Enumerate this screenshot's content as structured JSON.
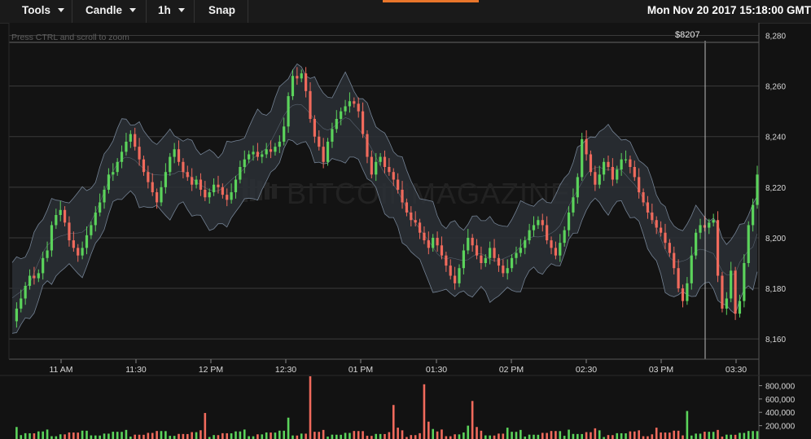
{
  "toolbar": {
    "tools_label": "Tools",
    "candle_label": "Candle",
    "interval_label": "1h",
    "snap_label": "Snap",
    "clock": "Mon Nov 20 2017 15:18:00 GMT"
  },
  "hint": "Press CTRL and scroll to zoom",
  "price_tag": "$8207",
  "watermark": "BITCOINMAGAZINE",
  "colors": {
    "up": "#5bd35b",
    "down": "#f06a5c",
    "band_fill": "#2b3036",
    "band_line": "#8a9bb0",
    "grid": "#3b3b3b"
  },
  "chart_data": {
    "type": "candlestick",
    "title": "",
    "y_ticks": [
      "8,280",
      "8,260",
      "8,240",
      "8,220",
      "8,200",
      "8,180",
      "8,160"
    ],
    "y_tick_values": [
      8280,
      8260,
      8240,
      8220,
      8200,
      8180,
      8160
    ],
    "ylim": [
      8152,
      8285
    ],
    "x_ticks": [
      "11 AM",
      "11:30",
      "12 PM",
      "12:30",
      "01 PM",
      "01:30",
      "02 PM",
      "02:30",
      "03 PM",
      "03:30"
    ],
    "price_series": [
      8167,
      8172,
      8176,
      8181,
      8185,
      8184,
      8186,
      8192,
      8195,
      8205,
      8209,
      8211,
      8206,
      8199,
      8196,
      8193,
      8196,
      8201,
      8205,
      8210,
      8214,
      8219,
      8225,
      8226,
      8230,
      8234,
      8238,
      8241,
      8236,
      8231,
      8226,
      8222,
      8218,
      8214,
      8220,
      8226,
      8232,
      8235,
      8230,
      8226,
      8224,
      8221,
      8223,
      8219,
      8216,
      8218,
      8221,
      8220,
      8217,
      8215,
      8218,
      8223,
      8228,
      8231,
      8233,
      8234,
      8232,
      8233,
      8235,
      8234,
      8236,
      8238,
      8244,
      8256,
      8264,
      8263,
      8265,
      8258,
      8247,
      8240,
      8236,
      8230,
      8238,
      8243,
      8247,
      8250,
      8252,
      8254,
      8253,
      8250,
      8241,
      8232,
      8225,
      8230,
      8232,
      8228,
      8226,
      8223,
      8219,
      8214,
      8210,
      8207,
      8206,
      8202,
      8199,
      8196,
      8200,
      8197,
      8193,
      8189,
      8185,
      8182,
      8188,
      8195,
      8200,
      8197,
      8193,
      8190,
      8192,
      8196,
      8192,
      8189,
      8186,
      8188,
      8192,
      8194,
      8196,
      8199,
      8203,
      8205,
      8207,
      8205,
      8199,
      8196,
      8193,
      8198,
      8203,
      8210,
      8216,
      8224,
      8239,
      8233,
      8226,
      8221,
      8225,
      8230,
      8228,
      8223,
      8227,
      8231,
      8231,
      8228,
      8224,
      8218,
      8214,
      8210,
      8207,
      8204,
      8202,
      8198,
      8194,
      8188,
      8180,
      8175,
      8182,
      8193,
      8202,
      8205,
      8204,
      8206,
      8207,
      8185,
      8172,
      8176,
      8187,
      8170,
      8175,
      8190,
      8205,
      8213,
      8225
    ],
    "band_offsets": [
      14,
      15,
      13,
      12,
      14,
      16,
      15,
      13,
      14,
      17,
      15,
      14,
      13,
      12,
      14,
      16,
      18,
      15,
      13,
      12
    ],
    "volume_ticks": [
      "800,000",
      "600,000",
      "400,000",
      "200,000"
    ],
    "volume_tick_values": [
      800000,
      600000,
      400000,
      200000
    ],
    "volume_max": 940000,
    "volume_spikes": [
      {
        "index": 1,
        "value": 180000
      },
      {
        "index": 44,
        "value": 390000
      },
      {
        "index": 63,
        "value": 320000
      },
      {
        "index": 68,
        "value": 960000
      },
      {
        "index": 87,
        "value": 510000
      },
      {
        "index": 88,
        "value": 170000
      },
      {
        "index": 94,
        "value": 820000
      },
      {
        "index": 95,
        "value": 260000
      },
      {
        "index": 96,
        "value": 150000
      },
      {
        "index": 104,
        "value": 200000
      },
      {
        "index": 105,
        "value": 570000
      },
      {
        "index": 106,
        "value": 180000
      },
      {
        "index": 113,
        "value": 170000
      },
      {
        "index": 127,
        "value": 140000
      },
      {
        "index": 133,
        "value": 160000
      },
      {
        "index": 143,
        "value": 130000
      },
      {
        "index": 147,
        "value": 170000
      },
      {
        "index": 154,
        "value": 420000
      },
      {
        "index": 171,
        "value": 170000
      },
      {
        "index": 177,
        "value": 140000
      }
    ]
  }
}
